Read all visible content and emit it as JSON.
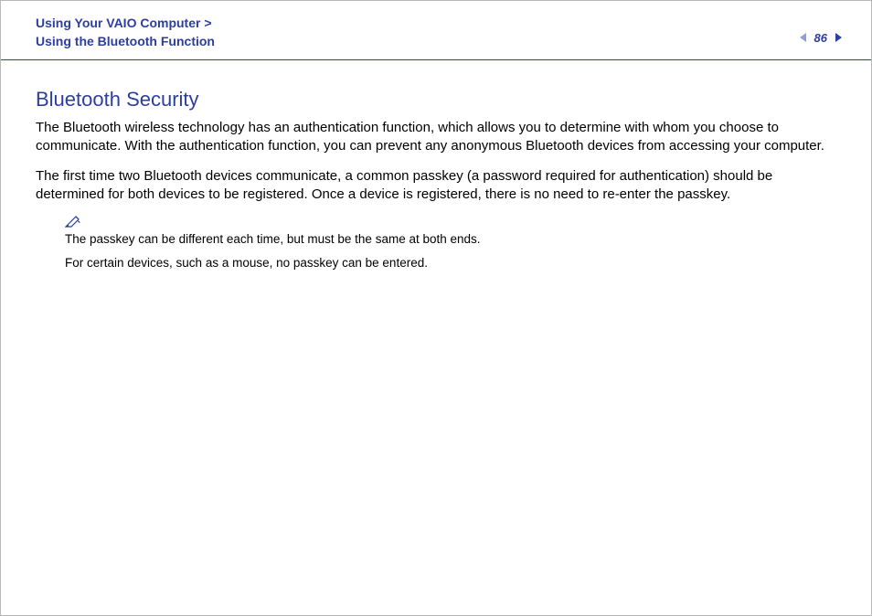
{
  "header": {
    "breadcrumb_line1": "Using Your VAIO Computer >",
    "breadcrumb_line2": "Using the Bluetooth Function",
    "page_number": "86"
  },
  "content": {
    "title": "Bluetooth Security",
    "paragraph1": "The Bluetooth wireless technology has an authentication function, which allows you to determine with whom you choose to communicate. With the authentication function, you can prevent any anonymous Bluetooth devices from accessing your computer.",
    "paragraph2": "The first time two Bluetooth devices communicate, a common passkey (a password required for authentication) should be determined for both devices to be registered. Once a device is registered, there is no need to re-enter the passkey.",
    "note1": "The passkey can be different each time, but must be the same at both ends.",
    "note2": "For certain devices, such as a mouse, no passkey can be entered."
  }
}
